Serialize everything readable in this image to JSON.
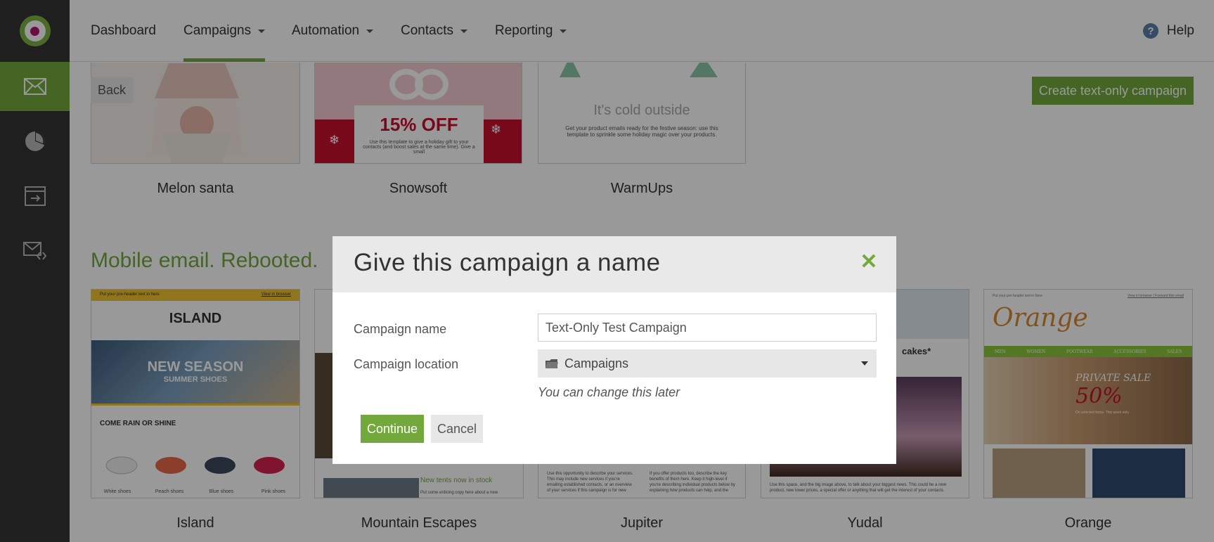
{
  "brand": {
    "accent": "#72a83c",
    "logo": "app-logo"
  },
  "sidebar": {
    "items": [
      {
        "icon": "envelope-icon",
        "active": true
      },
      {
        "icon": "pie-chart-icon",
        "active": false
      },
      {
        "icon": "automation-icon",
        "active": false
      },
      {
        "icon": "email-code-icon",
        "active": false
      }
    ]
  },
  "nav": {
    "items": [
      {
        "label": "Dashboard",
        "dropdown": false
      },
      {
        "label": "Campaigns",
        "dropdown": true,
        "active": true
      },
      {
        "label": "Automation",
        "dropdown": true
      },
      {
        "label": "Contacts",
        "dropdown": true
      },
      {
        "label": "Reporting",
        "dropdown": true
      }
    ],
    "help_label": "Help"
  },
  "toolbar": {
    "back_label": "Back",
    "create_text_only_label": "Create text-only campaign"
  },
  "templates_top": [
    {
      "name": "Melon santa"
    },
    {
      "name": "Snowsoft",
      "promo": "15% OFF",
      "promo_text": "Use this template to give a holiday gift to your contacts (and boost sales at the same time). Give a small"
    },
    {
      "name": "WarmUps",
      "headline": "It's cold outside",
      "body": "Get your product emails ready for the festive season: use this template to sprinkle some holiday magic over your products."
    }
  ],
  "section": {
    "title": "Mobile email. Rebooted."
  },
  "templates_bottom": [
    {
      "name": "Island",
      "preheader": "Put your pre-header text in here",
      "view_link": "View in browser",
      "logo": "ISLAND",
      "banner_main": "NEW SEASON",
      "banner_sub": "SUMMER SHOES",
      "heading": "COME RAIN OR SHINE",
      "products": [
        "White shoes",
        "Peach shoes",
        "Blue shoes",
        "Pink shoes"
      ]
    },
    {
      "name": "Mountain Escapes",
      "heading": "New tents now in stock",
      "body": "Put some enticing copy here about a new"
    },
    {
      "name": "Jupiter",
      "col1": "Use this opportunity to describe your services. This may include new services if you're emailing established contacts, or an overview of your services if this campaign is for new",
      "col2": "If you offer products too, describe the key benefits of them here. Keep it high-level if you're describing individual products below by explaining how products can help, and the"
    },
    {
      "name": "Yudal",
      "heading": "cakes*",
      "body": "Use this space, and the big image above, to talk about your biggest news. This could be a new product, new lower prices, a special offer or anything that will get the interest of your contacts."
    },
    {
      "name": "Orange",
      "preheader": "Put your pre-header text in here",
      "links": "View in browser | Forward this email",
      "logo": "Orange",
      "nav": [
        "MEN",
        "WOMEN",
        "FOOTWEAR",
        "ACCESSORIES",
        "SALES"
      ],
      "sale": "PRIVATE SALE",
      "sale_pct": "50%",
      "sale_note": "On selected items. This week only."
    }
  ],
  "modal": {
    "title": "Give this campaign a name",
    "name_label": "Campaign name",
    "name_value": "Text-Only Test Campaign",
    "location_label": "Campaign location",
    "location_value": "Campaigns",
    "hint": "You can change this later",
    "continue_label": "Continue",
    "cancel_label": "Cancel"
  }
}
